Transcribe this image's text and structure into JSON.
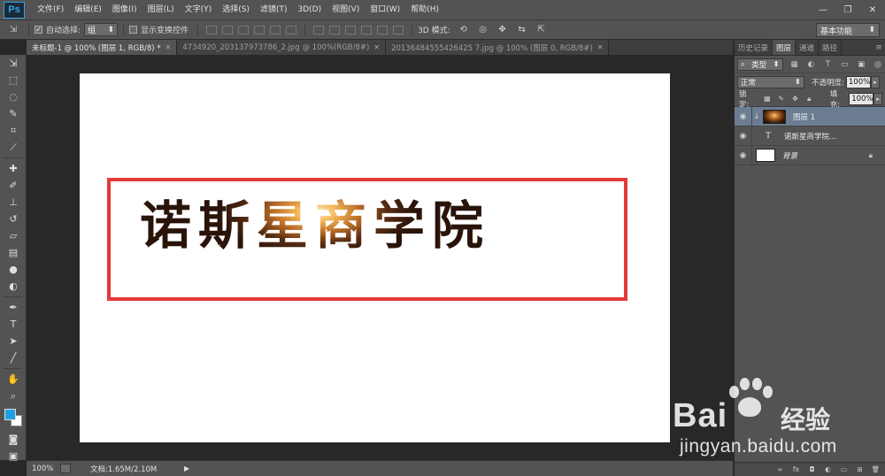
{
  "app": {
    "logo": "Ps"
  },
  "menu": [
    "文件(F)",
    "编辑(E)",
    "图像(I)",
    "图层(L)",
    "文字(Y)",
    "选择(S)",
    "滤镜(T)",
    "3D(D)",
    "视图(V)",
    "窗口(W)",
    "帮助(H)"
  ],
  "window_controls": {
    "minimize": "—",
    "restore": "❐",
    "close": "✕"
  },
  "options": {
    "auto_select_label": "自动选择:",
    "auto_select_value": "组",
    "show_transform_label": "显示变换控件",
    "mode_3d_label": "3D 模式:",
    "workspace": "基本功能"
  },
  "tabs": [
    {
      "label": "未标题-1 @ 100% (图层 1, RGB/8) *",
      "active": true
    },
    {
      "label": "4734920_203137973786_2.jpg @ 100%(RGB/8#)",
      "active": false
    },
    {
      "label": "20136484555426425 7.jpg @ 100% (图层 0, RGB/8#)",
      "active": false
    }
  ],
  "canvas": {
    "text": "诺斯星商学院"
  },
  "status": {
    "zoom": "100%",
    "doc": "文档:1.65M/2.10M",
    "arrow": "▶"
  },
  "panel": {
    "tabs": [
      "历史记录",
      "图层",
      "通道",
      "路径"
    ],
    "active_tab": "图层",
    "filter_kind": "类型",
    "blend_mode": "正常",
    "opacity_label": "不透明度:",
    "opacity_value": "100%",
    "lock_label": "锁定:",
    "fill_label": "填充:",
    "fill_value": "100%",
    "layers": [
      {
        "name": "图层 1",
        "type": "image",
        "selected": true
      },
      {
        "name": "诺斯星商学院...",
        "type": "text",
        "selected": false
      },
      {
        "name": "背景",
        "type": "background",
        "selected": false
      }
    ]
  },
  "watermark": {
    "brand": "Bai",
    "brand_cn": "经验",
    "url": "jingyan.baidu.com"
  },
  "colors": {
    "foreground": "#1da0e3",
    "background": "#ffffff",
    "selection": "#e3393b",
    "accent": "#2fa6e6"
  }
}
